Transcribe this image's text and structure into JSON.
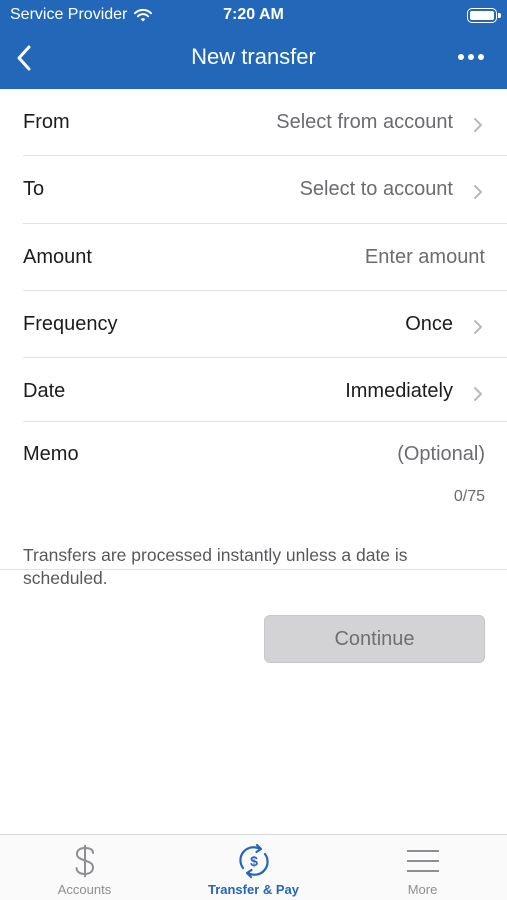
{
  "status_bar": {
    "carrier": "Service Provider",
    "time": "7:20 AM"
  },
  "nav": {
    "title": "New transfer",
    "back_icon": "chevron-left-icon",
    "more_icon": "ellipsis-icon"
  },
  "form": {
    "from": {
      "label": "From",
      "value": "Select from account"
    },
    "to": {
      "label": "To",
      "value": "Select to account"
    },
    "amount": {
      "label": "Amount",
      "placeholder": "Enter amount"
    },
    "frequency": {
      "label": "Frequency",
      "value": "Once"
    },
    "date": {
      "label": "Date",
      "value": "Immediately"
    },
    "memo": {
      "label": "Memo",
      "placeholder": "(Optional)",
      "counter": "0/75"
    }
  },
  "note": "Transfers are processed instantly unless a date is scheduled.",
  "continue_label": "Continue",
  "tabbar": {
    "tabs": [
      {
        "label": "Accounts",
        "icon": "dollar-icon",
        "active": false
      },
      {
        "label": "Transfer & Pay",
        "icon": "transfer-pay-icon",
        "active": true
      },
      {
        "label": "More",
        "icon": "menu-icon",
        "active": false
      }
    ]
  },
  "colors": {
    "brand": "#2368b8",
    "inactive_tab": "#8e8e93",
    "button_disabled": "#d3d3d5"
  }
}
